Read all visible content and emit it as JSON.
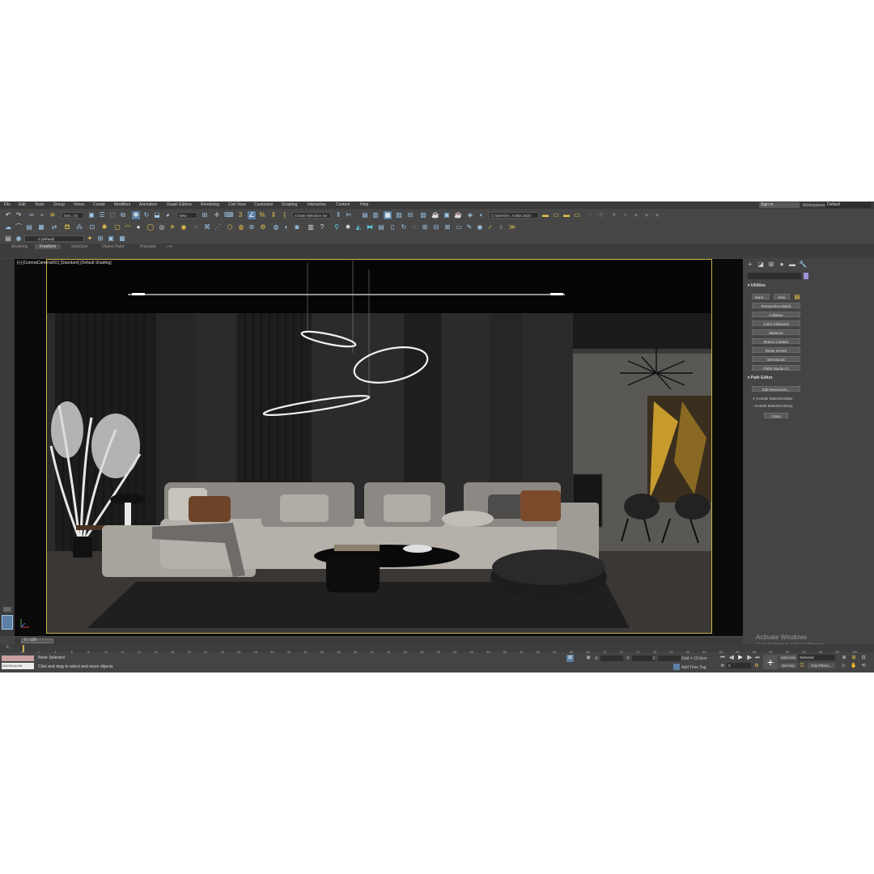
{
  "menubar": {
    "items": [
      "File",
      "Edit",
      "Tools",
      "Group",
      "Views",
      "Create",
      "Modifiers",
      "Animation",
      "Graph Editors",
      "Rendering",
      "Civil View",
      "Customize",
      "Scripting",
      "Interactive",
      "Content",
      "Help"
    ],
    "signin": "Sign In",
    "workspaces_label": "Workspaces:",
    "workspaces_value": "Default"
  },
  "toolbar": {
    "selection_filter": "Geo...try",
    "reference_coord": "View",
    "named_selection": "Create Selection Se",
    "project_path": "C:\\Users\\H...s Max 2020",
    "layer": "0 (default)"
  },
  "ribbon": {
    "tabs": [
      "Modeling",
      "Freeform",
      "Selection",
      "Object Paint",
      "Populate"
    ],
    "active": "Freeform"
  },
  "viewport": {
    "label": "[+] [CoronaCamera001] [Standard] [Default Shading]"
  },
  "watermark": {
    "title": "Activate Windows",
    "subtitle": "Go to Settings to activate Windows."
  },
  "command_panel": {
    "utilities_title": "Utilities",
    "more_button": "More...",
    "sets_button": "Sets",
    "utilities": [
      "Perspective Match",
      "Collapse",
      "Color Clipboard",
      "Measure",
      "Motion Capture",
      "Reset XForm",
      "MAXScript",
      "Flight Studio (c)"
    ],
    "path_editor_title": "Path Editor",
    "edit_resources": "Edit Resources...",
    "include_material_editor": "Include Material Editor",
    "include_material_library": "Include Material Library",
    "close_button": "Close",
    "accent_color": "#9b93d9"
  },
  "timeline": {
    "slider_label": "0 / 100",
    "ticks": [
      "0",
      "2",
      "4",
      "6",
      "8",
      "10",
      "12",
      "14",
      "16",
      "18",
      "20",
      "22",
      "24",
      "26",
      "28",
      "30",
      "32",
      "34",
      "36",
      "38",
      "40",
      "42",
      "44",
      "46",
      "48",
      "50",
      "52",
      "54",
      "56",
      "58",
      "60",
      "62",
      "64",
      "66",
      "68",
      "70",
      "72",
      "74",
      "76",
      "78",
      "80",
      "82",
      "84",
      "86",
      "88",
      "90",
      "92",
      "94",
      "96",
      "98",
      "100"
    ]
  },
  "status": {
    "maxscript": "MAXScript Mi:",
    "selection": "None Selected",
    "prompt": "Click and drag to select and move objects",
    "x_label": "X:",
    "y_label": "Y:",
    "z_label": "Z:",
    "grid": "Grid = 10.0cm",
    "add_time_tag": "Add Time Tag",
    "auto_key": "Auto Key",
    "set_key": "Set Key",
    "selected": "Selected",
    "key_filters": "Key Filters...",
    "frame": "0"
  }
}
